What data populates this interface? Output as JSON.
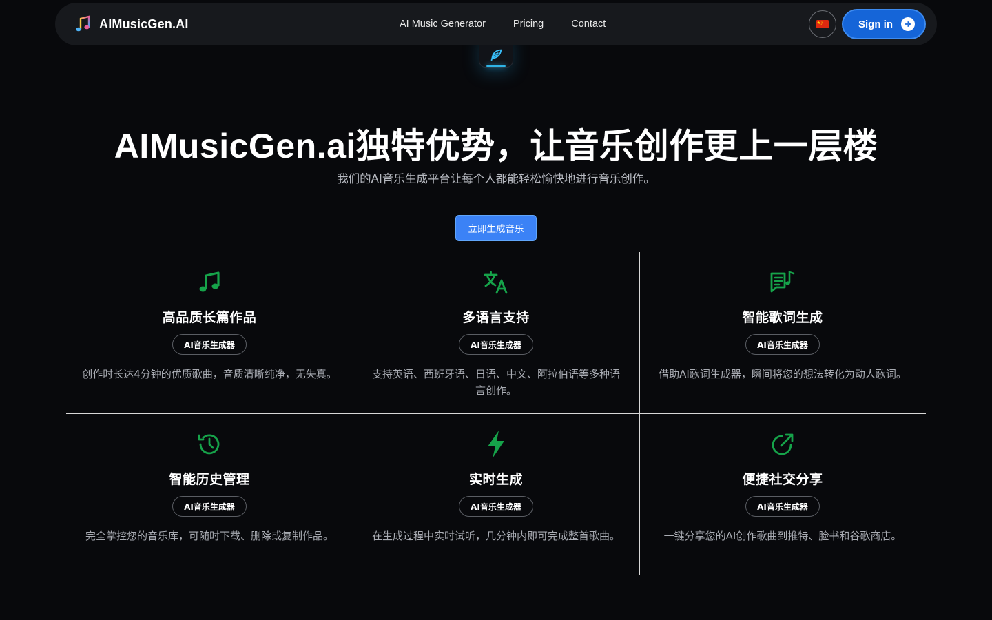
{
  "header": {
    "brand": "AIMusicGen.AI",
    "nav": [
      "AI Music Generator",
      "Pricing",
      "Contact"
    ],
    "signin_label": "Sign in"
  },
  "hero": {
    "title": "AIMusicGen.ai独特优势，让音乐创作更上一层楼",
    "subtitle": "我们的AI音乐生成平台让每个人都能轻松愉快地进行音乐创作。",
    "cta_label": "立即生成音乐"
  },
  "features": [
    {
      "icon": "music-note-icon",
      "title": "高品质长篇作品",
      "badge": "AI音乐生成器",
      "desc": "创作时长达4分钟的优质歌曲，音质清晰纯净，无失真。"
    },
    {
      "icon": "translate-icon",
      "title": "多语言支持",
      "badge": "AI音乐生成器",
      "desc": "支持英语、西班牙语、日语、中文、阿拉伯语等多种语言创作。"
    },
    {
      "icon": "lyrics-icon",
      "title": "智能歌词生成",
      "badge": "AI音乐生成器",
      "desc": "借助AI歌词生成器，瞬间将您的想法转化为动人歌词。"
    },
    {
      "icon": "history-icon",
      "title": "智能历史管理",
      "badge": "AI音乐生成器",
      "desc": "完全掌控您的音乐库，可随时下载、删除或复制作品。"
    },
    {
      "icon": "lightning-icon",
      "title": "实时生成",
      "badge": "AI音乐生成器",
      "desc": "在生成过程中实时试听，几分钟内即可完成整首歌曲。"
    },
    {
      "icon": "share-icon",
      "title": "便捷社交分享",
      "badge": "AI音乐生成器",
      "desc": "一键分享您的AI创作歌曲到推特、脸书和谷歌商店。"
    }
  ],
  "colors": {
    "accent": "#1565d8",
    "feature_icon": "#16a34a",
    "cta": "#3b82f6",
    "background": "#08090c"
  }
}
